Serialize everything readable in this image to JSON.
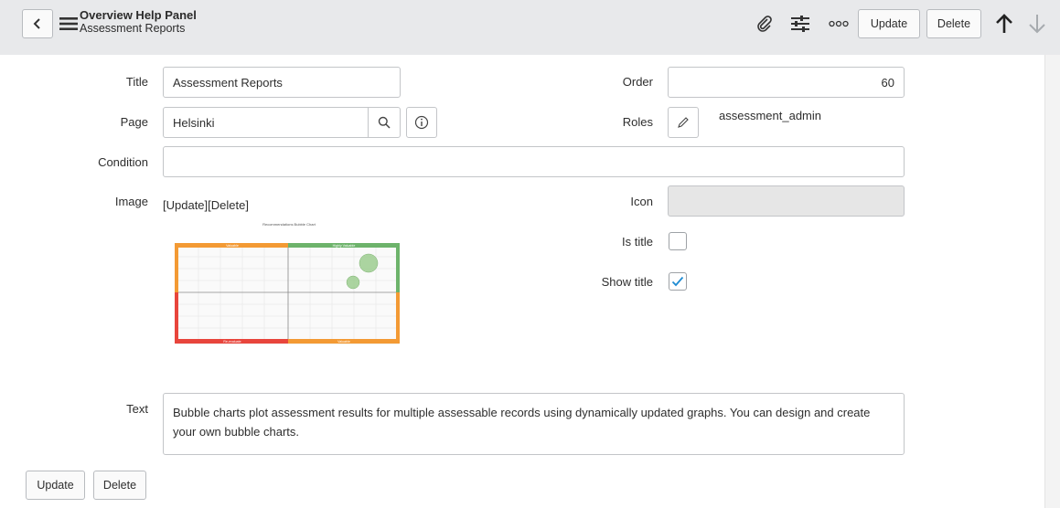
{
  "header": {
    "title": "Overview Help Panel",
    "subtitle": "Assessment Reports",
    "update_label": "Update",
    "delete_label": "Delete"
  },
  "form": {
    "title_label": "Title",
    "title_value": "Assessment Reports",
    "page_label": "Page",
    "page_value": "Helsinki",
    "condition_label": "Condition",
    "condition_value": "",
    "image_label": "Image",
    "image_links": "[Update][Delete]",
    "text_label": "Text",
    "text_value": "Bubble charts plot assessment results for multiple assessable records using dynamically updated graphs. You can design and create your own bubble charts.",
    "order_label": "Order",
    "order_value": "60",
    "roles_label": "Roles",
    "roles_value": "assessment_admin",
    "icon_label": "Icon",
    "icon_value": "",
    "is_title_label": "Is title",
    "is_title_checked": false,
    "show_title_label": "Show title",
    "show_title_checked": true
  },
  "footer": {
    "update_label": "Update",
    "delete_label": "Delete"
  },
  "thumbnail": {
    "chart_title": "Recommendations Bubble Chart",
    "top_left_label": "Valuable",
    "top_right_label": "Highly Valuable",
    "bottom_left_label": "Re-evaluate",
    "bottom_right_label": "Valuable"
  },
  "colors": {
    "header_bg": "#e8e9eb",
    "accent_check": "#1f8cd3",
    "quadrant_orange": "#f39a34",
    "quadrant_green": "#6db36b",
    "quadrant_red": "#e8453c",
    "bubble": "#9ccc8f"
  },
  "icons": [
    "back-icon",
    "menu-icon",
    "paperclip-icon",
    "sliders-icon",
    "more-icon",
    "arrow-up-icon",
    "arrow-down-icon",
    "search-icon",
    "info-icon",
    "pencil-icon",
    "check-icon"
  ]
}
